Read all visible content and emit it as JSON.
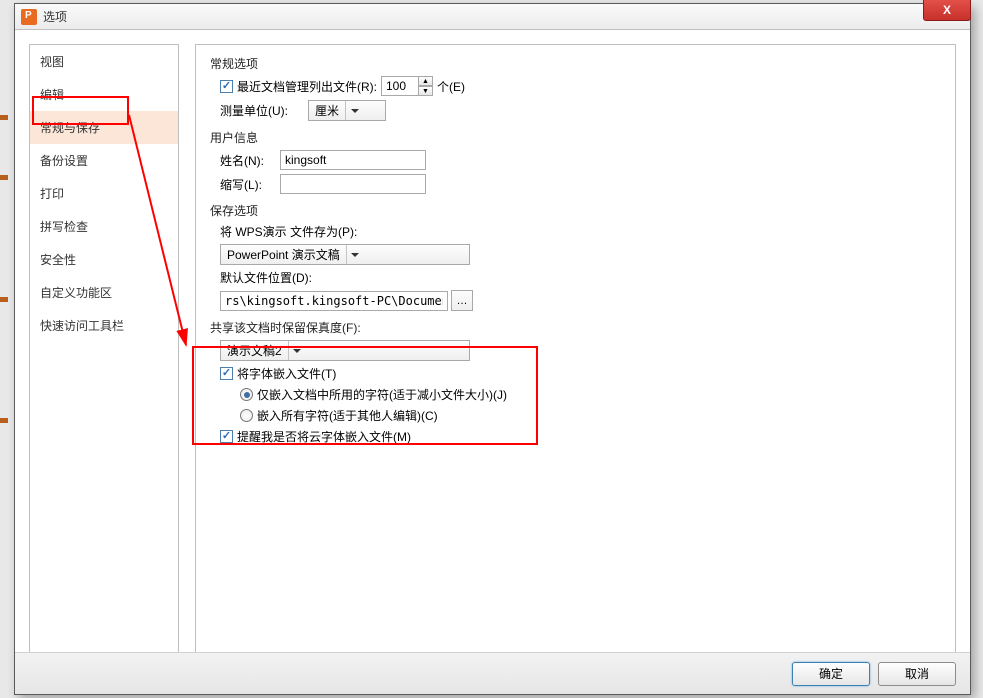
{
  "title": "选项",
  "sidebar": {
    "items": [
      {
        "label": "视图"
      },
      {
        "label": "编辑"
      },
      {
        "label": "常规与保存"
      },
      {
        "label": "备份设置"
      },
      {
        "label": "打印"
      },
      {
        "label": "拼写检查"
      },
      {
        "label": "安全性"
      },
      {
        "label": "自定义功能区"
      },
      {
        "label": "快速访问工具栏"
      }
    ],
    "selected_index": 2
  },
  "sections": {
    "general": {
      "title": "常规选项",
      "recentFiles": {
        "label": "最近文档管理列出文件(R):",
        "value": "100",
        "unit": "个(E)",
        "checked": true
      },
      "measureUnit": {
        "label": "测量单位(U):",
        "value": "厘米"
      }
    },
    "user": {
      "title": "用户信息",
      "name": {
        "label": "姓名(N):",
        "value": "kingsoft"
      },
      "initials": {
        "label": "缩写(L):",
        "value": ""
      }
    },
    "save": {
      "title": "保存选项",
      "saveAs": {
        "label": "将 WPS演示 文件存为(P):",
        "value": "PowerPoint 演示文稿"
      },
      "defaultLocation": {
        "label": "默认文件位置(D):",
        "value": "rs\\kingsoft.kingsoft-PC\\Documents"
      }
    },
    "fidelity": {
      "title": "共享该文档时保留保真度(F):",
      "doc": "演示文稿2",
      "embedFonts": {
        "label": "将字体嵌入文件(T)",
        "checked": true
      },
      "embedUsed": {
        "label": "仅嵌入文档中所用的字符(适于减小文件大小)(J)",
        "checked": true
      },
      "embedAll": {
        "label": "嵌入所有字符(适于其他人编辑)(C)",
        "checked": false
      },
      "notifyCloud": {
        "label": "提醒我是否将云字体嵌入文件(M)",
        "checked": true
      }
    }
  },
  "footer": {
    "ok": "确定",
    "cancel": "取消"
  }
}
